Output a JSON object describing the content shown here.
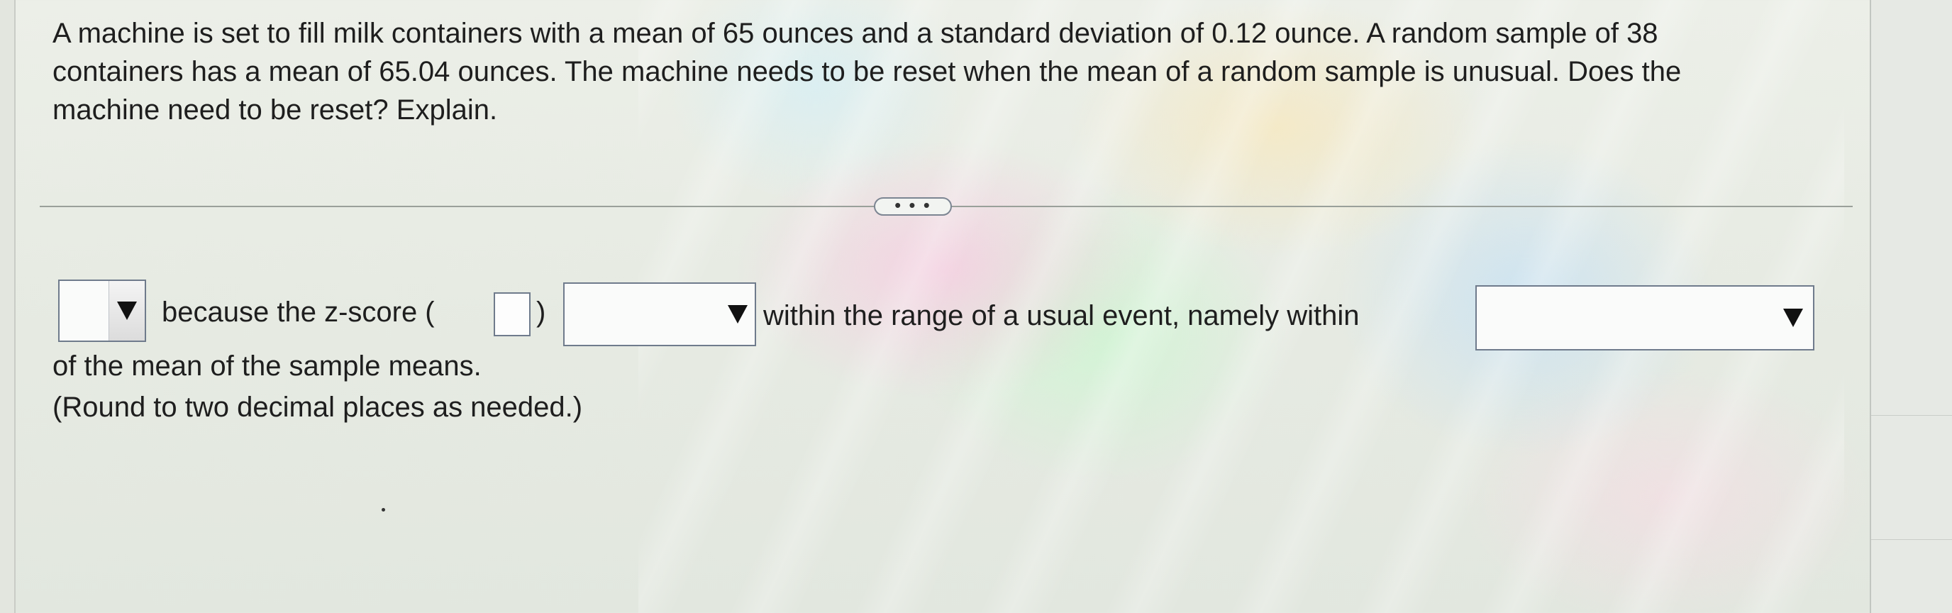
{
  "question": {
    "text": "A machine is set to fill milk containers with a mean of 65 ounces and a standard deviation of 0.12 ounce. A random sample of 38 containers has a mean of 65.04 ounces. The machine needs to be reset when the mean of a random sample is unusual. Does the machine need to be reset? Explain."
  },
  "divider": {
    "more_label": "• • •"
  },
  "answer": {
    "dropdown1_value": "",
    "text_because": "because the z-score (",
    "zscore_value": "",
    "text_close_paren": ")",
    "dropdown2_value": "",
    "text_within_range": "within the range of a usual event, namely within",
    "dropdown3_value": "",
    "text_of_mean": "of the mean of the sample means.",
    "text_round": "(Round to two decimal places as needed.)"
  }
}
